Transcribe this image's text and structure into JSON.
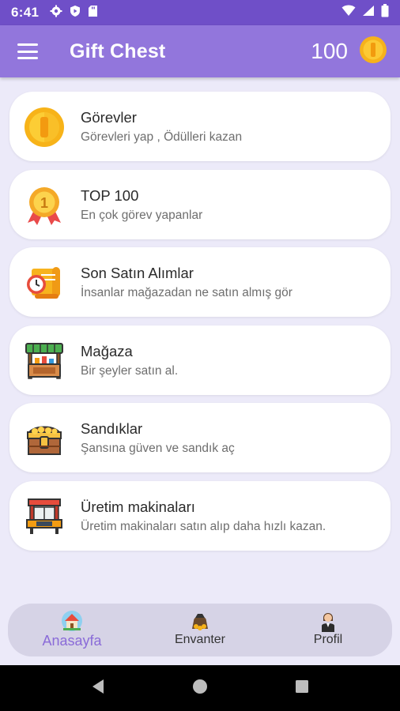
{
  "status_bar": {
    "time": "6:41"
  },
  "app_bar": {
    "title": "Gift Chest",
    "coin_count": "100"
  },
  "colors": {
    "primary": "#9276dc",
    "status_bar": "#6f4fc8",
    "active_nav": "#8a6bd8",
    "background": "#eceaf9"
  },
  "menu": [
    {
      "icon": "coin-icon",
      "title": "Görevler",
      "subtitle": "Görevleri yap , Ödülleri kazan"
    },
    {
      "icon": "medal-icon",
      "title": "TOP 100",
      "subtitle": "En çok görev yapanlar"
    },
    {
      "icon": "scroll-clock-icon",
      "title": "Son Satın Alımlar",
      "subtitle": "İnsanlar mağazadan ne satın almış gör"
    },
    {
      "icon": "shop-stall-icon",
      "title": "Mağaza",
      "subtitle": "Bir şeyler satın al."
    },
    {
      "icon": "treasure-chest-icon",
      "title": "Sandıklar",
      "subtitle": "Şansına güven ve sandık aç"
    },
    {
      "icon": "machine-icon",
      "title": "Üretim makinaları",
      "subtitle": "Üretim makinaları satın alıp daha hızlı kazan."
    }
  ],
  "bottom_nav": [
    {
      "icon": "home-icon",
      "label": "Anasayfa",
      "active": true
    },
    {
      "icon": "inventory-icon",
      "label": "Envanter",
      "active": false
    },
    {
      "icon": "profile-icon",
      "label": "Profil",
      "active": false
    }
  ]
}
